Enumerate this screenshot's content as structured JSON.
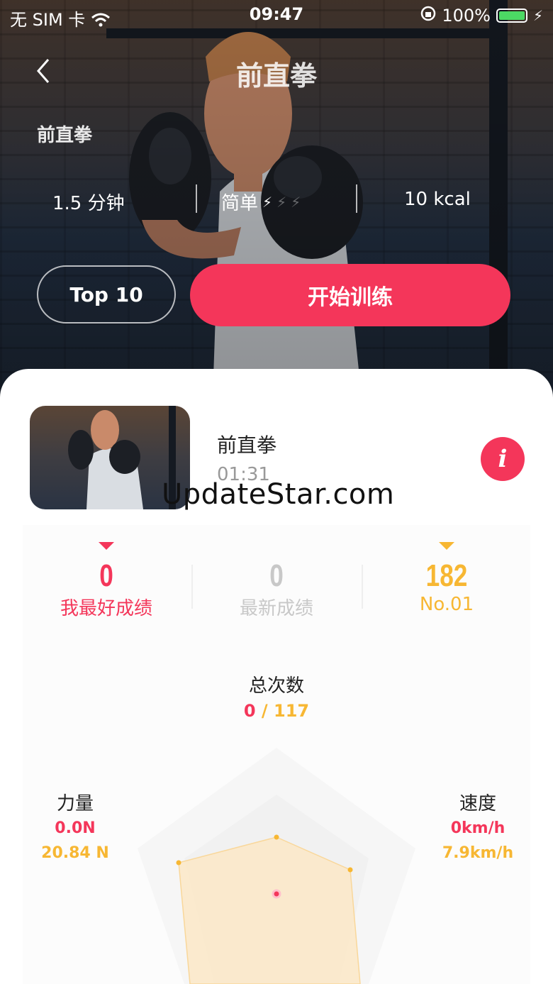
{
  "status_bar": {
    "carrier": "无 SIM 卡",
    "time": "09:47",
    "battery_pct": "100%"
  },
  "header": {
    "title": "前直拳"
  },
  "hero": {
    "subtitle": "前直拳",
    "duration": "1.5 分钟",
    "difficulty": "简单",
    "difficulty_level": 1,
    "difficulty_max": 3,
    "calories": "10 kcal",
    "top_button": "Top 10",
    "start_button": "开始训练"
  },
  "exercise": {
    "name": "前直拳",
    "time": "01:31"
  },
  "watermark": "UpdateStar.com",
  "scores": [
    {
      "value": "0",
      "label": "我最好成绩",
      "color": "#f4365a"
    },
    {
      "value": "0",
      "label": "最新成绩",
      "color": "#c8c8c8"
    },
    {
      "value": "182",
      "label": "No.01",
      "color": "#f7b733"
    }
  ],
  "total": {
    "label": "总次数",
    "current": "0",
    "target": "117"
  },
  "metrics": {
    "power": {
      "label": "力量",
      "current": "0.0N",
      "best": "20.84 N"
    },
    "speed": {
      "label": "速度",
      "current": "0km/h",
      "best": "7.9km/h"
    }
  },
  "colors": {
    "accent": "#f4365a",
    "gold": "#f7b733"
  }
}
